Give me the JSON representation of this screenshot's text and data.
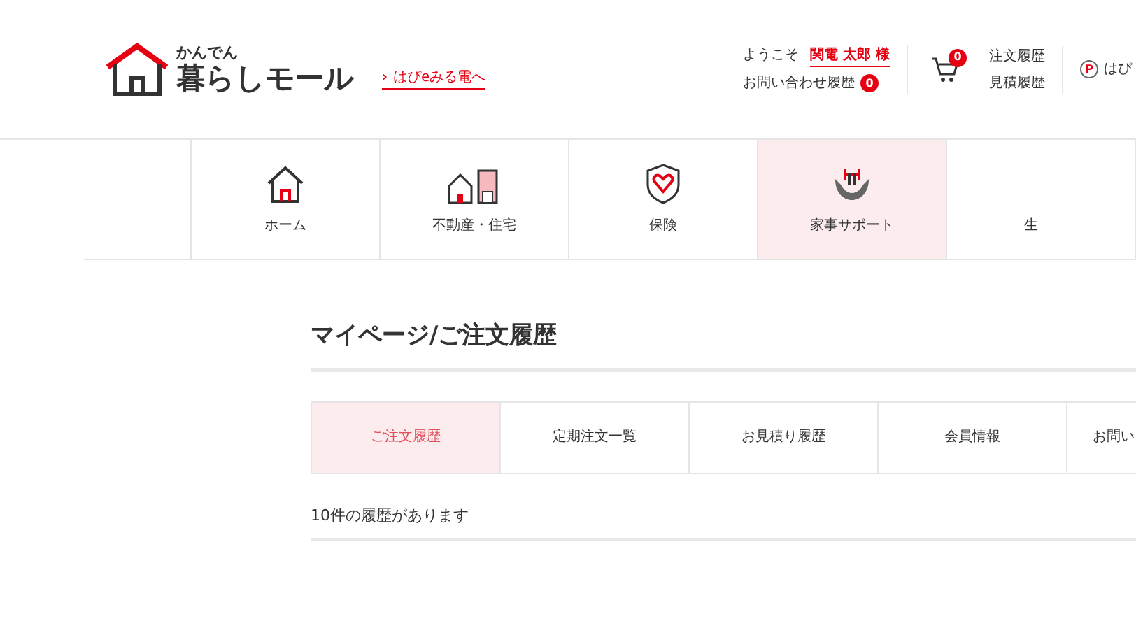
{
  "logo": {
    "kicker": "かんでん",
    "name": "暮らしモール"
  },
  "header_link": {
    "icon": "›",
    "label": "はぴeみる電へ"
  },
  "account": {
    "welcome": "ようこそ",
    "user": "関電 太郎",
    "honorific": "様",
    "inquiry": "お問い合わせ履歴",
    "inquiry_count": "0"
  },
  "cart": {
    "count": "0"
  },
  "history_links": [
    "注文履歴",
    "見積履歴"
  ],
  "points": {
    "icon": "P",
    "label": "はぴ"
  },
  "nav": [
    {
      "label": "ホーム",
      "kind": "home",
      "selected": false
    },
    {
      "label": "不動産・住宅",
      "kind": "realestate",
      "selected": false
    },
    {
      "label": "保険",
      "kind": "insurance",
      "selected": false
    },
    {
      "label": "家事サポート",
      "kind": "housework",
      "selected": true
    },
    {
      "label": "生",
      "kind": "none",
      "selected": false
    }
  ],
  "page_title": "マイページ/ご注文履歴",
  "tabs": [
    {
      "label": "ご注文履歴",
      "selected": true
    },
    {
      "label": "定期注文一覧",
      "selected": false
    },
    {
      "label": "お見積り履歴",
      "selected": false
    },
    {
      "label": "会員情報",
      "selected": false
    },
    {
      "label": "お問い",
      "selected": false
    }
  ],
  "result_count": "10件の履歴があります"
}
